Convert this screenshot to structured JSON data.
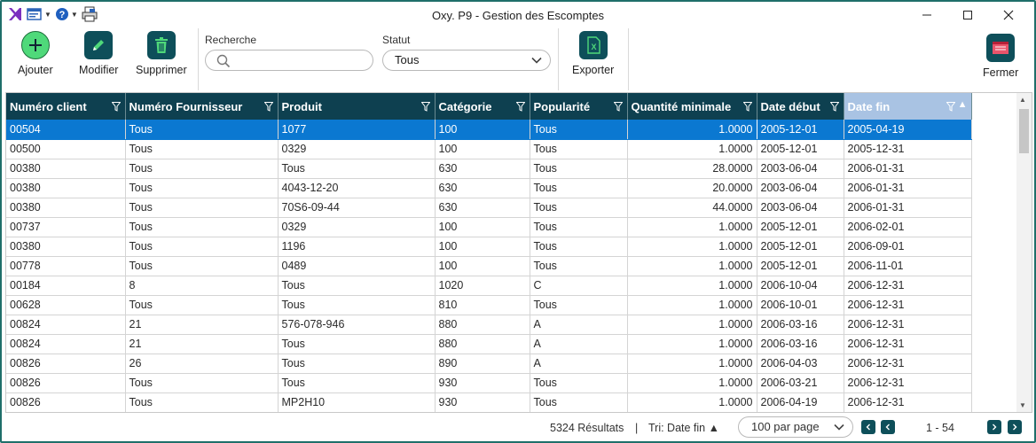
{
  "window": {
    "title": "Oxy. P9 - Gestion des Escomptes"
  },
  "toolbar": {
    "add_label": "Ajouter",
    "edit_label": "Modifier",
    "delete_label": "Supprimer",
    "export_label": "Exporter",
    "close_label": "Fermer"
  },
  "filters": {
    "search_label": "Recherche",
    "search_value": "",
    "status_label": "Statut",
    "status_value": "Tous"
  },
  "grid": {
    "columns": [
      "Numéro client",
      "Numéro Fournisseur",
      "Produit",
      "Catégorie",
      "Popularité",
      "Quantité minimale",
      "Date début",
      "Date fin"
    ],
    "rows": [
      [
        "00504",
        "Tous",
        "1077",
        "100",
        "Tous",
        "1.0000",
        "2005-12-01",
        "2005-04-19"
      ],
      [
        "00500",
        "Tous",
        "0329",
        "100",
        "Tous",
        "1.0000",
        "2005-12-01",
        "2005-12-31"
      ],
      [
        "00380",
        "Tous",
        "Tous",
        "630",
        "Tous",
        "28.0000",
        "2003-06-04",
        "2006-01-31"
      ],
      [
        "00380",
        "Tous",
        "4043-12-20",
        "630",
        "Tous",
        "20.0000",
        "2003-06-04",
        "2006-01-31"
      ],
      [
        "00380",
        "Tous",
        "70S6-09-44",
        "630",
        "Tous",
        "44.0000",
        "2003-06-04",
        "2006-01-31"
      ],
      [
        "00737",
        "Tous",
        "0329",
        "100",
        "Tous",
        "1.0000",
        "2005-12-01",
        "2006-02-01"
      ],
      [
        "00380",
        "Tous",
        "1196",
        "100",
        "Tous",
        "1.0000",
        "2005-12-01",
        "2006-09-01"
      ],
      [
        "00778",
        "Tous",
        "0489",
        "100",
        "Tous",
        "1.0000",
        "2005-12-01",
        "2006-11-01"
      ],
      [
        "00184",
        "8",
        "Tous",
        "1020",
        "C",
        "1.0000",
        "2006-10-04",
        "2006-12-31"
      ],
      [
        "00628",
        "Tous",
        "Tous",
        "810",
        "Tous",
        "1.0000",
        "2006-10-01",
        "2006-12-31"
      ],
      [
        "00824",
        "21",
        "576-078-946",
        "880",
        "A",
        "1.0000",
        "2006-03-16",
        "2006-12-31"
      ],
      [
        "00824",
        "21",
        "Tous",
        "880",
        "A",
        "1.0000",
        "2006-03-16",
        "2006-12-31"
      ],
      [
        "00826",
        "26",
        "Tous",
        "890",
        "A",
        "1.0000",
        "2006-04-03",
        "2006-12-31"
      ],
      [
        "00826",
        "Tous",
        "Tous",
        "930",
        "Tous",
        "1.0000",
        "2006-03-21",
        "2006-12-31"
      ],
      [
        "00826",
        "Tous",
        "MP2H10",
        "930",
        "Tous",
        "1.0000",
        "2006-04-19",
        "2006-12-31"
      ]
    ]
  },
  "status": {
    "results": "5324 Résultats",
    "divider": "|",
    "sort": "Tri: Date fin ▲",
    "per_page": "100 par page",
    "page_range": "1 - 54"
  },
  "colors": {
    "header": "#0e4050",
    "selected": "#0b78d1",
    "accent": "#1f6f6a"
  }
}
